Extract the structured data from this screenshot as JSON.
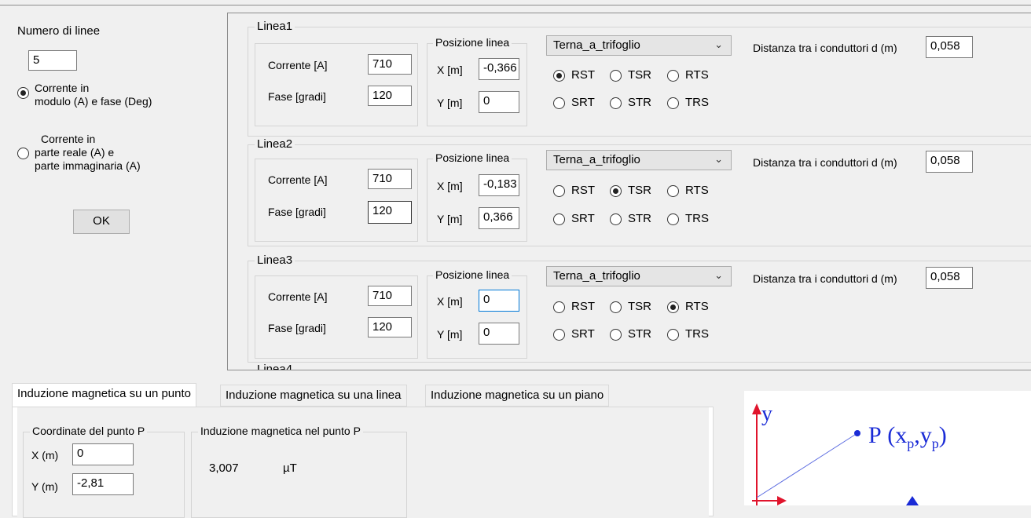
{
  "left_panel": {
    "numero_label": "Numero di linee",
    "numero_value": "5",
    "radio1_line1": "Corrente in",
    "radio1_line2": "modulo (A) e fase (Deg)",
    "radio2_line1": "Corrente in",
    "radio2_line2": "parte reale (A) e",
    "radio2_line3": "parte immaginaria (A)",
    "ok_label": "OK"
  },
  "common": {
    "corrente_label": "Corrente [A]",
    "fase_label": "Fase [gradi]",
    "posizione_title": "Posizione linea",
    "x_label": "X [m]",
    "y_label": "Y [m]",
    "distanza_label": "Distanza tra i conduttori d (m)",
    "phase_options": [
      "RST",
      "TSR",
      "RTS",
      "SRT",
      "STR",
      "TRS"
    ]
  },
  "lines": [
    {
      "title": "Linea1",
      "corrente": "710",
      "fase": "120",
      "x": "-0,366",
      "y": "0",
      "config": "Terna_a_trifoglio",
      "distanza": "0,058",
      "selected_phase": "RST"
    },
    {
      "title": "Linea2",
      "corrente": "710",
      "fase": "120",
      "x": "-0,183",
      "y": "0,366",
      "config": "Terna_a_trifoglio",
      "distanza": "0,058",
      "selected_phase": "TSR"
    },
    {
      "title": "Linea3",
      "corrente": "710",
      "fase": "120",
      "x": "0",
      "y": "0",
      "config": "Terna_a_trifoglio",
      "distanza": "0,058",
      "selected_phase": "RTS"
    }
  ],
  "linea4_partial": "Linea4",
  "tabs": [
    {
      "label": "Induzione magnetica su un punto",
      "active": true
    },
    {
      "label": "Induzione magnetica su una linea",
      "active": false
    },
    {
      "label": "Induzione magnetica su un piano",
      "active": false
    }
  ],
  "point_panel": {
    "coord_title": "Coordinate del punto P",
    "x_label": "X (m)",
    "x_value": "0",
    "y_label": "Y (m)",
    "y_value": "-2,81",
    "induzione_title": "Induzione magnetica nel punto P",
    "induzione_value": "3,007",
    "induzione_unit": "µT"
  },
  "diagram": {
    "y_axis_label": "y",
    "point_label_P": "P",
    "point_label_x": "x",
    "point_label_y": "y",
    "point_label_sub": "p",
    "axis_color": "#e0142c",
    "point_color": "#1a2bd6"
  }
}
